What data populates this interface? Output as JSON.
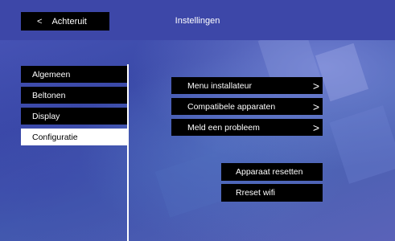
{
  "header": {
    "back_chevron": "<",
    "back_label": "Achteruit",
    "title": "Instellingen"
  },
  "sidebar": {
    "items": [
      {
        "label": "Algemeen",
        "active": false
      },
      {
        "label": "Beltonen",
        "active": false
      },
      {
        "label": "Display",
        "active": false
      },
      {
        "label": "Configuratie",
        "active": true
      }
    ]
  },
  "main": {
    "menu": [
      {
        "label": "Menu installateur",
        "arrow": ">"
      },
      {
        "label": "Compatibele apparaten",
        "arrow": ">"
      },
      {
        "label": "Meld een probleem",
        "arrow": ">"
      }
    ],
    "actions": [
      {
        "label": "Apparaat resetten"
      },
      {
        "label": "Rreset wifi"
      }
    ]
  },
  "colors": {
    "background": "#3a4aa8",
    "header_bar": "#3d47a8",
    "button": "#000000",
    "button_text": "#ffffff",
    "active_item": "#ffffff"
  }
}
